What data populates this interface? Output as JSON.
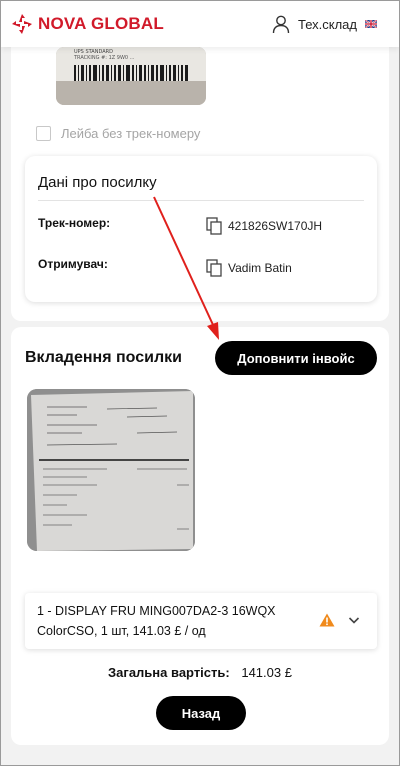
{
  "header": {
    "brand": "NOVA GLOBAL",
    "account_label": "Тех.склад",
    "brand_color": "#d11a2a"
  },
  "label_section": {
    "photo_icon": "shipping-label-photo",
    "no_tracking_checkbox": {
      "label": "Лейба без трек-номеру",
      "checked": false
    }
  },
  "parcel_info": {
    "title": "Дані про посилку",
    "fields": [
      {
        "key": "Трек-номер:",
        "value": "421826SW170JH",
        "icon": "copy-icon"
      },
      {
        "key": "Отримувач:",
        "value": "Vadim Batin",
        "icon": "copy-icon"
      }
    ]
  },
  "attachments": {
    "title": "Вкладення посилки",
    "complete_invoice_button": "Доповнити інвойс",
    "photo_icon": "invoice-photo",
    "item": {
      "line1": "1 - DISPLAY FRU MING007DA2-3 16WQX",
      "line2": "ColorCSO, 1 шт, 141.03 £ / од",
      "warning_color": "#f08a1c"
    },
    "total": {
      "label": "Загальна вартість:",
      "value": "141.03 £"
    },
    "back_button": "Назад"
  },
  "annotation": {
    "arrow_color": "#e0201c"
  }
}
